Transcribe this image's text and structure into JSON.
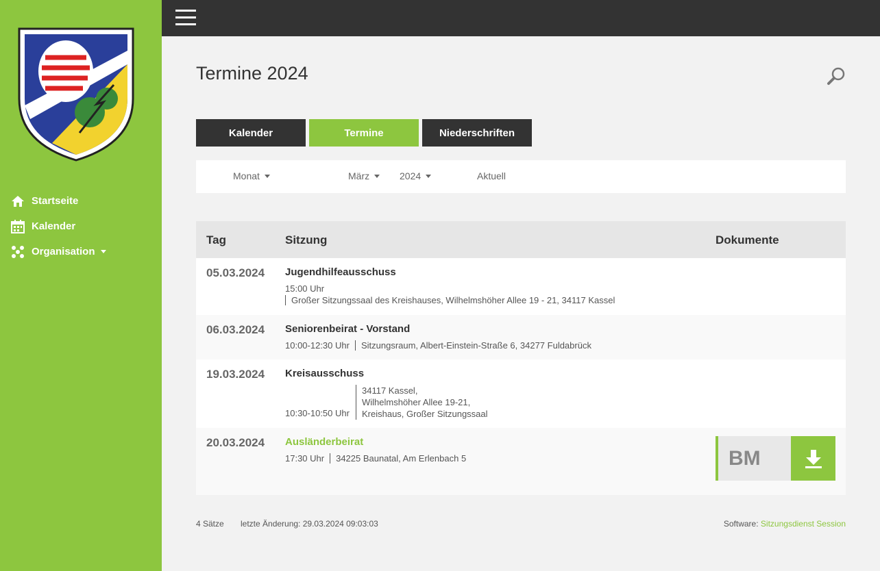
{
  "nav": {
    "items": [
      {
        "label": "Startseite",
        "icon": "home-icon"
      },
      {
        "label": "Kalender",
        "icon": "calendar-icon"
      },
      {
        "label": "Organisation",
        "icon": "organization-icon"
      }
    ]
  },
  "page": {
    "title": "Termine 2024"
  },
  "tabs": [
    "Kalender",
    "Termine",
    "Niederschriften"
  ],
  "filter": {
    "mode": "Monat",
    "month": "März",
    "year": "2024",
    "current": "Aktuell",
    "prev_glyph": "",
    "next_glyph": ""
  },
  "table": {
    "headers": {
      "day": "Tag",
      "sort_glyph": "",
      "session": "Sitzung",
      "documents": "Dokumente"
    },
    "rows": [
      {
        "date": "05.03.2024",
        "name": "Jugendhilfeausschuss",
        "time": "15:00 Uhr",
        "location": "Großer Sitzungssaal des Kreishauses, Wilhelmshöher Allee 19 - 21, 34117 Kassel"
      },
      {
        "date": "06.03.2024",
        "name": "Seniorenbeirat - Vorstand",
        "time": "10:00-12:30 Uhr",
        "location": "Sitzungsraum, Albert-Einstein-Straße 6, 34277 Fuldabrück"
      },
      {
        "date": "19.03.2024",
        "name": "Kreisausschuss",
        "time": "10:30-10:50 Uhr",
        "location_lines": [
          "34117 Kassel,",
          "Wilhelmshöher Allee 19-21,",
          "Kreishaus, Großer Sitzungssaal"
        ]
      },
      {
        "date": "20.03.2024",
        "name": "Ausländerbeirat",
        "time": "17:30 Uhr",
        "location": "34225 Baunatal, Am Erlenbach 5",
        "doc_label": "BM"
      }
    ]
  },
  "footer": {
    "records_glyph": "",
    "records": "4 Sätze",
    "changed_glyph": "",
    "last_change": "letzte Änderung: 29.03.2024 09:03:03",
    "software_label": "Software:",
    "software_link": "Sitzungsdienst Session"
  },
  "colors": {
    "accent": "#8dc63f",
    "dark": "#333333"
  }
}
